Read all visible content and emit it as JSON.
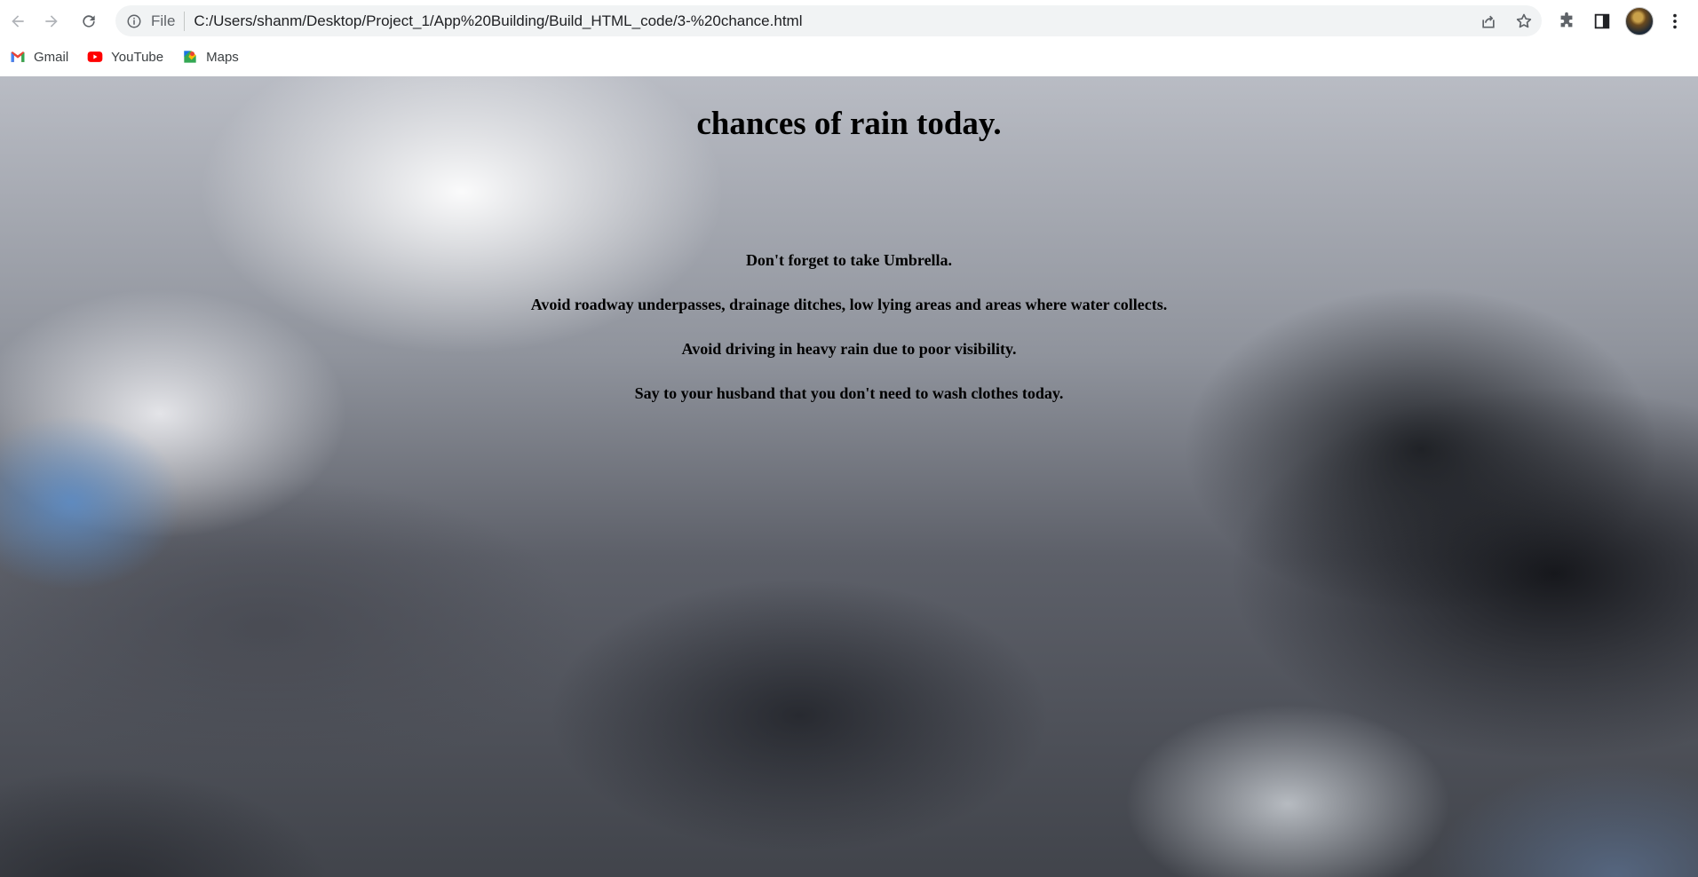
{
  "browser": {
    "address_bar": {
      "chip_label": "File",
      "url": "C:/Users/shanm/Desktop/Project_1/App%20Building/Build_HTML_code/3-%20chance.html"
    },
    "bookmarks": [
      {
        "label": "Gmail",
        "icon": "gmail-icon"
      },
      {
        "label": "YouTube",
        "icon": "youtube-icon"
      },
      {
        "label": "Maps",
        "icon": "maps-icon"
      }
    ]
  },
  "page": {
    "title": "chances of rain today.",
    "tips": [
      "Don't forget to take Umbrella.",
      "Avoid roadway underpasses, drainage ditches, low lying areas and areas where water collects.",
      "Avoid driving in heavy rain due to poor visibility.",
      "Say to your husband that you don't need to wash clothes today."
    ],
    "background": "stormy cloudy sky"
  },
  "colors": {
    "chrome_bg": "#ffffff",
    "omnibox_bg": "#f1f3f4",
    "text": "#000000"
  }
}
